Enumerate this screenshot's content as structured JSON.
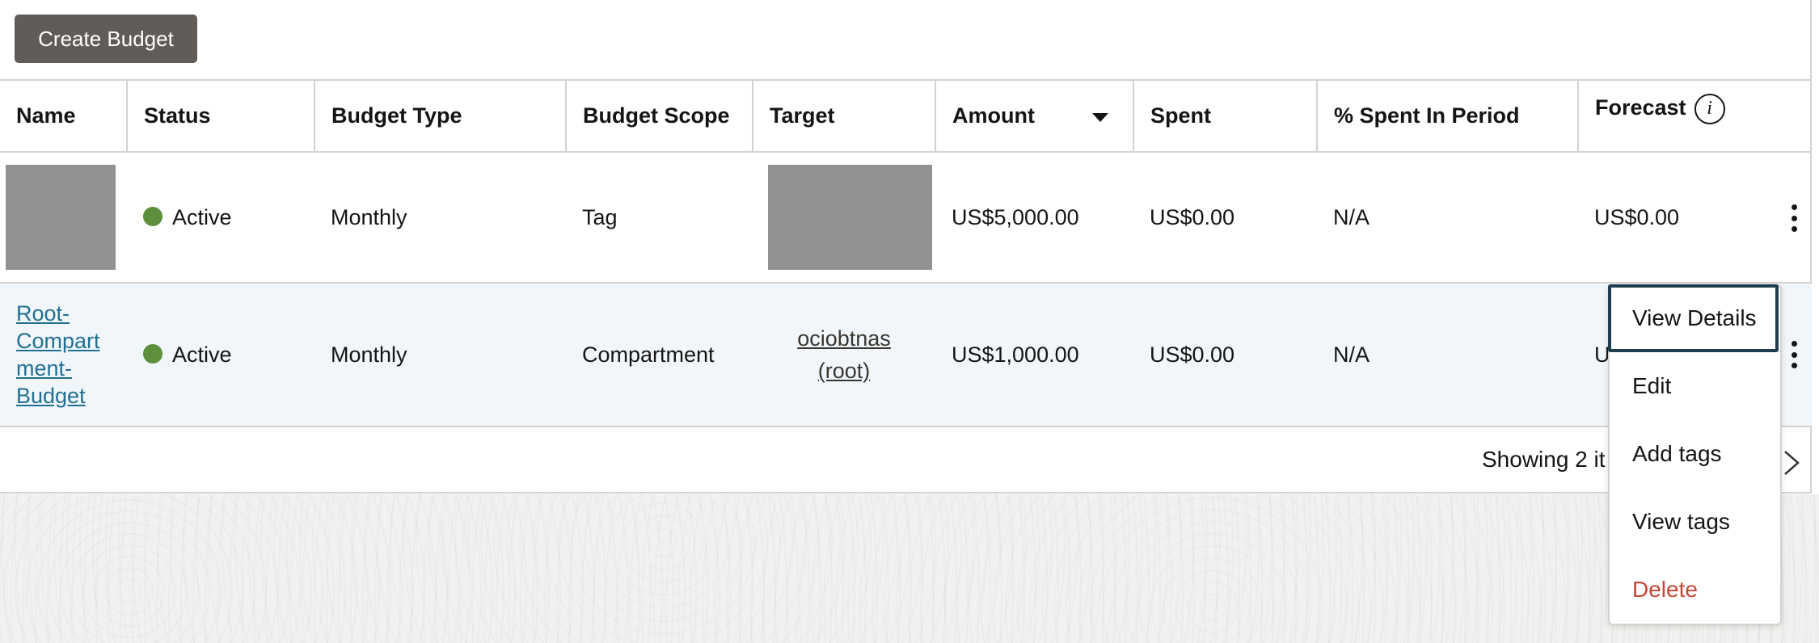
{
  "toolbar": {
    "create_label": "Create Budget"
  },
  "table": {
    "columns": [
      "Name",
      "Status",
      "Budget Type",
      "Budget Scope",
      "Target",
      "Amount",
      "Spent",
      "% Spent In Period",
      "Forecast"
    ],
    "rows": [
      {
        "name": "",
        "status": "Active",
        "budget_type": "Monthly",
        "budget_scope": "Tag",
        "target": "",
        "amount": "US$5,000.00",
        "spent": "US$0.00",
        "pct_spent": "N/A",
        "forecast": "US$0.00"
      },
      {
        "name": "Root-Compart ment-Budget",
        "name_lines": [
          "Root-",
          "Compart",
          "ment-",
          "Budget"
        ],
        "status": "Active",
        "budget_type": "Monthly",
        "budget_scope": "Compartment",
        "target_lines": [
          "ociobtnas",
          "(root)"
        ],
        "amount": "US$1,000.00",
        "spent": "US$0.00",
        "pct_spent": "N/A",
        "forecast": "U"
      }
    ]
  },
  "footer": {
    "showing_text": "Showing 2 it"
  },
  "action_menu": {
    "items": [
      "View Details",
      "Edit",
      "Add tags",
      "View tags",
      "Delete"
    ]
  },
  "colors": {
    "primary_button": "#625c58",
    "status_active": "#5d8f3c",
    "link": "#227093",
    "danger": "#c74634",
    "focus_ring": "#1f3d4f",
    "selected_row": "#f1f6fa"
  }
}
